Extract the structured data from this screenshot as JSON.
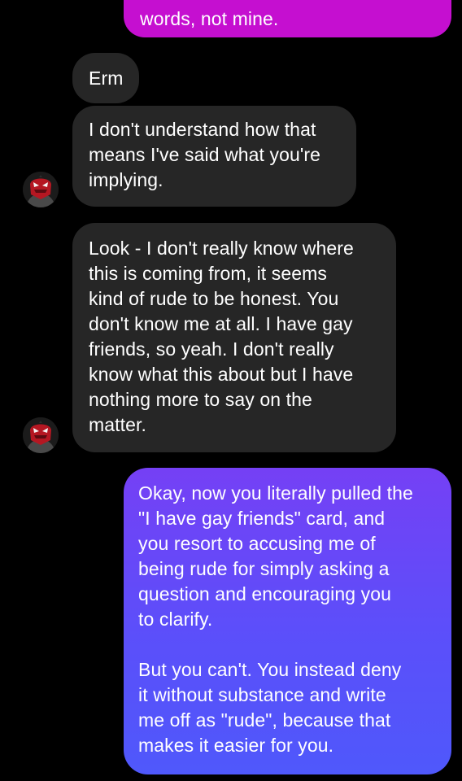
{
  "messages": {
    "sent_top": "words, not mine.",
    "erm": "Erm",
    "understand": "I don't understand how that\nmeans I've said what you're\nimplying.",
    "look": "Look - I don't really know where\nthis is coming from, it seems\nkind of rude to be honest. You\ndon't know me at all. I have gay\nfriends, so yeah. I don't really\nknow what this about but I have\nnothing more to say on the\nmatter.",
    "reply": "Okay, now you literally pulled the\n\"I have gay friends\" card, and\nyou resort to accusing me of\nbeing rude for simply asking a\nquestion and encouraging you\nto clarify.\n\nBut you can't. You instead deny\nit without substance and write\nme off as \"rude\", because that\nmakes it easier for you."
  },
  "colors": {
    "background": "#000000",
    "incoming_bubble": "#262626",
    "sent_top_bubble": "#c50fd0",
    "sent_gradient_start": "#7540f5",
    "sent_gradient_end": "#4f58fb"
  },
  "avatar": {
    "icon": "masked-character-avatar-icon"
  }
}
